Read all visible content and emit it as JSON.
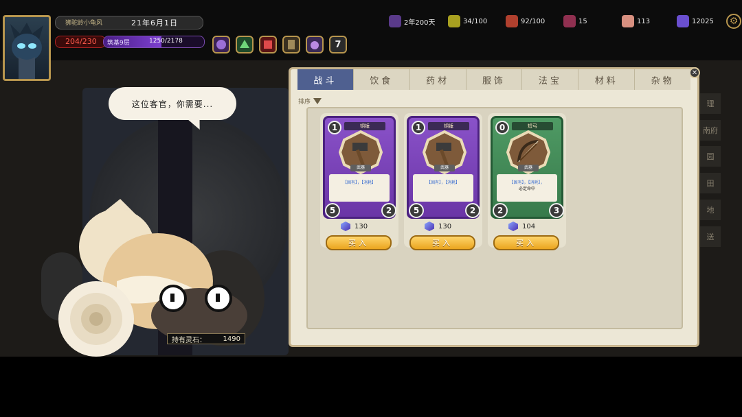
{
  "header": {
    "name": "狮驼岭小龟风",
    "date": "21年6月1日",
    "hp": "204/230",
    "realm": "筑基9层",
    "cult_progress": "1250/2178",
    "cult_ratio": 0.574,
    "skills": [
      {
        "name": "skill-1-icon",
        "color": "#6b3fa0"
      },
      {
        "name": "skill-2-icon",
        "color": "#3f8a4a"
      },
      {
        "name": "skill-3-icon",
        "color": "#b02a2a"
      },
      {
        "name": "skill-4-icon",
        "color": "#6a5a3a"
      },
      {
        "name": "skill-5-icon",
        "color": "#7a5ab0"
      },
      {
        "name": "skill-count",
        "label": "7"
      }
    ]
  },
  "resources": [
    {
      "icon": "lifespan-icon",
      "value": "2年200天",
      "color": "#7a5ab0"
    },
    {
      "icon": "food-icon",
      "value": "34/100",
      "color": "#c8c030"
    },
    {
      "icon": "health-icon",
      "value": "92/100",
      "color": "#c0503a"
    },
    {
      "icon": "gourd-icon",
      "value": "15",
      "color": "#a04060"
    },
    {
      "icon": "favor-icon",
      "value": "113",
      "color": "#e0a090"
    },
    {
      "icon": "spirit-stone-icon",
      "value": "12025",
      "color": "#6a4fd0"
    }
  ],
  "dialog": {
    "speech": "这位客官，你需要...",
    "spirit_label": "持有灵石：",
    "spirit_value": "1490"
  },
  "shop": {
    "tabs": [
      "战斗",
      "饮食",
      "药材",
      "服饰",
      "法宝",
      "材料",
      "杂物"
    ],
    "active_tab": 0,
    "sort_label": "排序",
    "buy_label": "买入",
    "items": [
      {
        "name": "铜锤",
        "type": "武器",
        "cost": "1",
        "desc": "【固有】，【消耗】",
        "desc2": "",
        "left": "5",
        "right": "2",
        "price": "130",
        "rarity": "purple",
        "icon": "hammer-icon"
      },
      {
        "name": "铜锤",
        "type": "武器",
        "cost": "1",
        "desc": "【固有】，【消耗】",
        "desc2": "",
        "left": "5",
        "right": "2",
        "price": "130",
        "rarity": "purple",
        "icon": "hammer-icon"
      },
      {
        "name": "短弓",
        "type": "武器",
        "cost": "0",
        "desc": "【固有】，【消耗】，",
        "desc2": "必定命中",
        "left": "2",
        "right": "3",
        "price": "104",
        "rarity": "green",
        "icon": "bow-icon"
      }
    ]
  },
  "side_labels": [
    "理",
    "南府",
    "园",
    "田",
    "地",
    "送"
  ]
}
